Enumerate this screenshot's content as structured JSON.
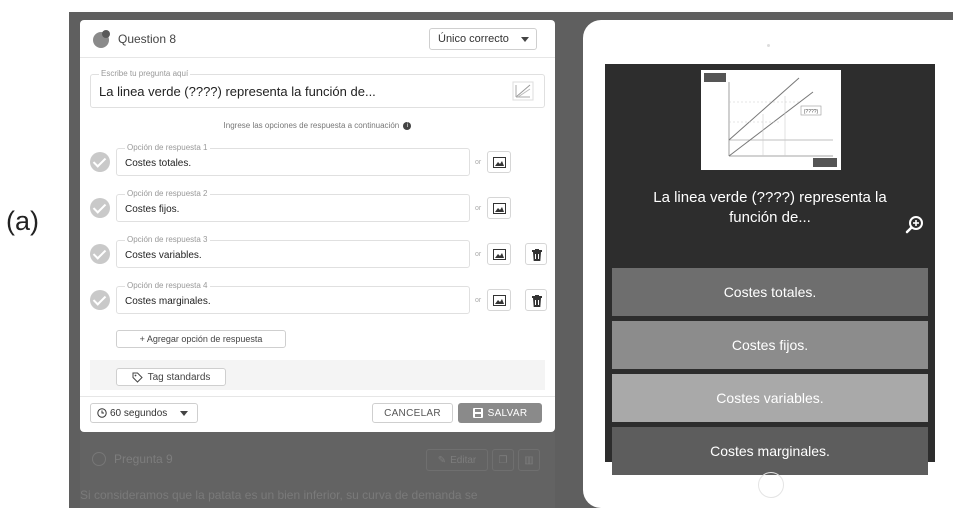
{
  "figure_label": "(a)",
  "editor": {
    "title": "Question 8",
    "type_select": "Único correcto",
    "question_legend": "Escribe tu pregunta aquí",
    "question_text": "La linea verde (????) representa la función de...",
    "hint": "Ingrese las opciones de respuesta a continuación",
    "or_label": "or",
    "options": [
      {
        "legend": "Opción de respuesta 1",
        "text": "Costes totales."
      },
      {
        "legend": "Opción de respuesta 2",
        "text": "Costes fijos."
      },
      {
        "legend": "Opción de respuesta 3",
        "text": "Costes variables."
      },
      {
        "legend": "Opción de respuesta 4",
        "text": "Costes marginales."
      }
    ],
    "add_option": "+ Agregar opción de respuesta",
    "tag_standards": "Tag standards",
    "time_select": "60 segundos",
    "cancel": "CANCELAR",
    "save": "SALVAR"
  },
  "next_question": {
    "title": "Pregunta 9",
    "edit": "Editar",
    "text": "Si consideramos que la patata es un bien inferior, su curva de demanda se"
  },
  "preview": {
    "question_text": "La linea verde (????) representa la función de...",
    "chart_label": "(????)",
    "answers": [
      {
        "text": "Costes totales.",
        "color": "#6e6e6e"
      },
      {
        "text": "Costes fijos.",
        "color": "#8c8c8c"
      },
      {
        "text": "Costes variables.",
        "color": "#a9a9a9"
      },
      {
        "text": "Costes marginales.",
        "color": "#5d5d5d"
      }
    ]
  },
  "colors": {
    "backdrop": "#5f5f5f",
    "save_button": "#8a8a8a",
    "check_circle": "#c9c9c9",
    "screen": "#2d2d2d"
  }
}
